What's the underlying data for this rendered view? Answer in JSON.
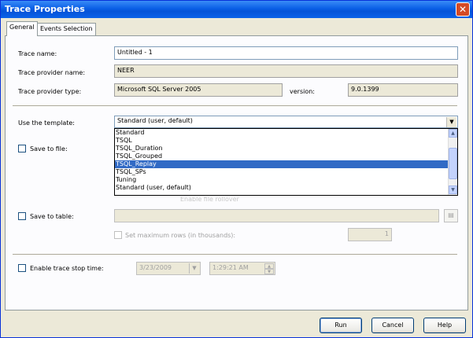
{
  "window": {
    "title": "Trace Properties",
    "close_glyph": "✕"
  },
  "tabs": [
    {
      "label": "General",
      "active": true
    },
    {
      "label": "Events Selection",
      "active": false
    }
  ],
  "general": {
    "trace_name_label": "Trace name:",
    "trace_name_value": "Untitled - 1",
    "provider_name_label": "Trace provider name:",
    "provider_name_value": "NEER",
    "provider_type_label": "Trace provider type:",
    "provider_type_value": "Microsoft SQL Server 2005",
    "version_label": "version:",
    "version_value": "9.0.1399",
    "template_label": "Use the template:",
    "template_selected": "Standard (user, default)",
    "template_options": [
      "Standard",
      "TSQL",
      "TSQL_Duration",
      "TSQL_Grouped",
      "TSQL_Replay",
      "TSQL_SPs",
      "Tuning",
      "Standard (user, default)"
    ],
    "highlighted_option": "TSQL_Replay",
    "save_to_file_label": "Save to file:",
    "save_to_table_label": "Save to table:",
    "set_max_rows_label": "Set maximum rows (in thousands):",
    "max_rows_value": "1",
    "enable_stop_time_label": "Enable trace stop time:",
    "stop_date_value": "3/23/2009",
    "stop_time_value": "1:29:21 AM",
    "partial_hidden_text": "Enable file rollover"
  },
  "footer": {
    "run_label": "Run",
    "cancel_label": "Cancel",
    "help_label": "Help"
  },
  "colors": {
    "title_bar": "#0a5fe6",
    "selection": "#316ac5",
    "dialog_bg": "#ece9d8"
  }
}
